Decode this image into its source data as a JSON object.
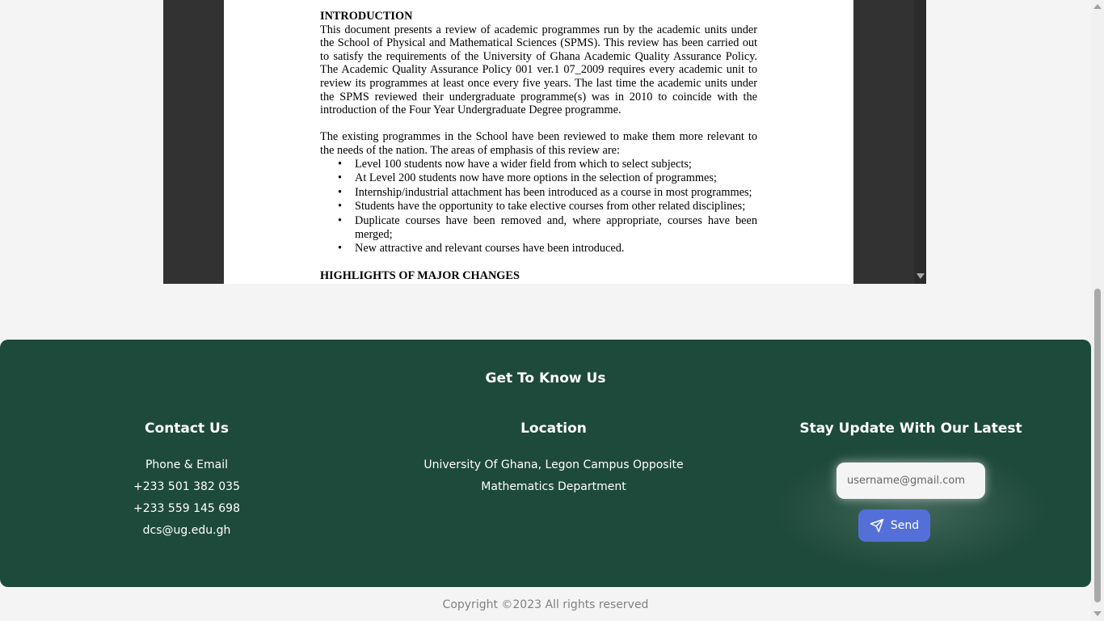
{
  "document": {
    "intro_heading": "INTRODUCTION",
    "intro_paragraph": "This document presents a review of academic programmes run by the academic units under the School of Physical and Mathematical Sciences (SPMS). This review has been carried out to satisfy the requirements of the University of Ghana Academic Quality Assurance Policy. The Academic Quality Assurance Policy 001 ver.1 07_2009 requires every academic unit to review its programmes at least once every five years. The last time the academic units under the SPMS reviewed their undergraduate programme(s) was in 2010 to coincide with the introduction of the Four Year Undergraduate Degree programme.",
    "emphasis_paragraph": "The existing programmes in the School have been reviewed to make them more relevant to the needs of the nation. The areas of emphasis of this review are:",
    "bullets": [
      "Level 100 students now have a wider field from which to select subjects;",
      "At Level 200 students now have more options in the selection of programmes;",
      "Internship/industrial attachment has been introduced as a course in most programmes;",
      "Students have the opportunity to take elective courses from other related disciplines;",
      "Duplicate courses have been removed and, where appropriate, courses have been merged;",
      "New attractive and relevant courses have been introduced."
    ],
    "bullet_glyph": "•",
    "highlights_heading": "HIGHLIGHTS OF MAJOR CHANGES"
  },
  "footer": {
    "heading": "Get To Know Us",
    "contact": {
      "title": "Contact Us",
      "lines": [
        "Phone & Email",
        "+233 501 382 035",
        "+233 559 145 698",
        "dcs@ug.edu.gh"
      ]
    },
    "location": {
      "title": "Location",
      "lines": [
        "University Of Ghana, Legon Campus Opposite",
        "Mathematics Department"
      ]
    },
    "newsletter": {
      "title": "Stay Update With Our Latest",
      "placeholder": "username@gmail.com",
      "send_label": "Send"
    },
    "colors": {
      "footer_bg": "#1e4a3b",
      "send_button": "#5470d8"
    }
  },
  "copyright": "Copyright ©2023 All rights reserved"
}
